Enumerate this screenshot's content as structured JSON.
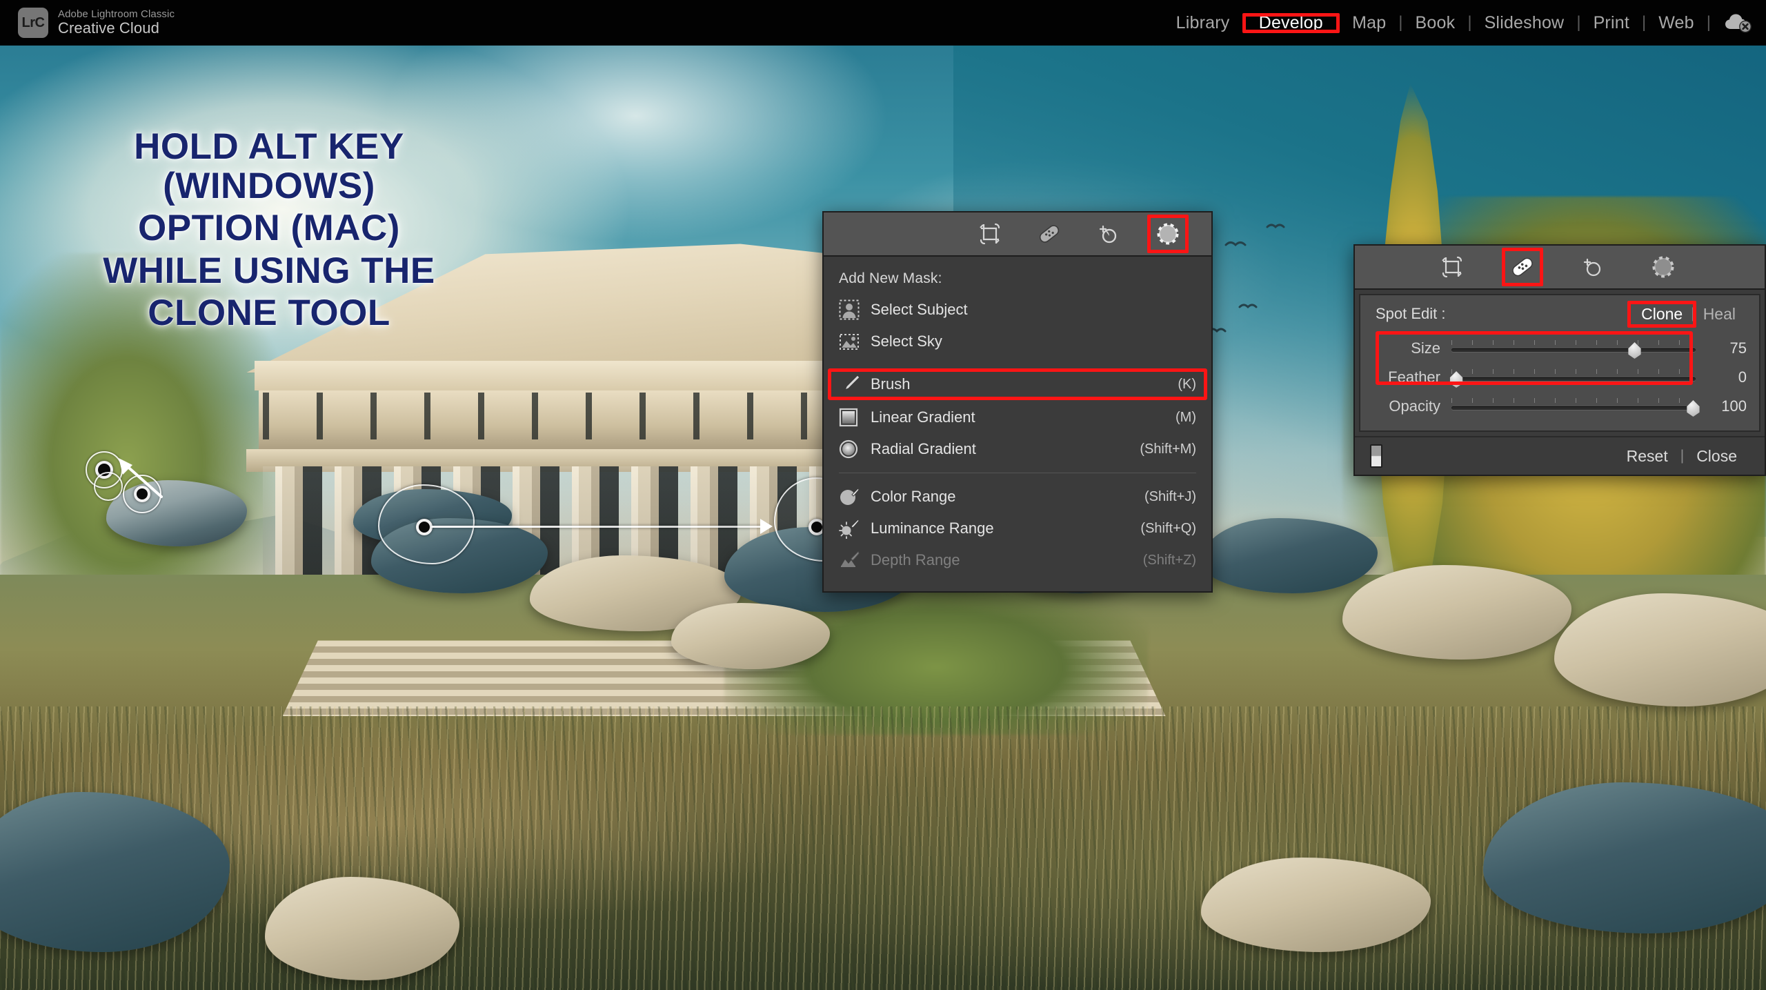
{
  "app": {
    "logo_text": "LrC",
    "product_line1": "Adobe Lightroom Classic",
    "product_line2": "Creative Cloud"
  },
  "modules": {
    "items": [
      {
        "label": "Library",
        "active": false
      },
      {
        "label": "Develop",
        "active": true,
        "highlighted": true
      },
      {
        "label": "Map",
        "active": false
      },
      {
        "label": "Book",
        "active": false
      },
      {
        "label": "Slideshow",
        "active": false
      },
      {
        "label": "Print",
        "active": false
      },
      {
        "label": "Web",
        "active": false
      }
    ],
    "separator": "|",
    "cloud_status_icon": "cloud-sync-off-icon"
  },
  "callout": {
    "line1": "HOLD ALT KEY (WINDOWS)",
    "line2": "OPTION (MAC)",
    "line3": "WHILE USING THE",
    "line4": "CLONE TOOL",
    "color": "#18256e",
    "glow": "#ffffff"
  },
  "mask_panel": {
    "toolbar": [
      {
        "icon": "crop-overlay-icon",
        "name": "crop-tool",
        "selected": false
      },
      {
        "icon": "healing-brush-icon",
        "name": "healing-tool",
        "selected": false
      },
      {
        "icon": "red-eye-icon",
        "name": "red-eye-tool",
        "selected": false
      },
      {
        "icon": "masking-circle-icon",
        "name": "masking-tool",
        "selected": true,
        "highlighted": true
      }
    ],
    "header": "Add New Mask:",
    "items": [
      {
        "label": "Select Subject",
        "shortcut": "",
        "icon": "select-subject-icon",
        "disabled": false,
        "highlighted": false
      },
      {
        "label": "Select Sky",
        "shortcut": "",
        "icon": "select-sky-icon",
        "disabled": false,
        "highlighted": false
      },
      {
        "label": "Brush",
        "shortcut": "(K)",
        "icon": "brush-icon",
        "disabled": false,
        "highlighted": true
      },
      {
        "label": "Linear Gradient",
        "shortcut": "(M)",
        "icon": "linear-gradient-icon",
        "disabled": false,
        "highlighted": false
      },
      {
        "label": "Radial Gradient",
        "shortcut": "(Shift+M)",
        "icon": "radial-gradient-icon",
        "disabled": false,
        "highlighted": false
      },
      {
        "label": "Color Range",
        "shortcut": "(Shift+J)",
        "icon": "color-range-icon",
        "disabled": false,
        "highlighted": false
      },
      {
        "label": "Luminance Range",
        "shortcut": "(Shift+Q)",
        "icon": "luminance-range-icon",
        "disabled": false,
        "highlighted": false
      },
      {
        "label": "Depth Range",
        "shortcut": "(Shift+Z)",
        "icon": "depth-range-icon",
        "disabled": true,
        "highlighted": false
      }
    ]
  },
  "spot_panel": {
    "toolbar": [
      {
        "icon": "crop-overlay-icon",
        "name": "crop-tool",
        "selected": false
      },
      {
        "icon": "healing-brush-icon",
        "name": "healing-tool",
        "selected": true,
        "highlighted": true
      },
      {
        "icon": "red-eye-icon",
        "name": "red-eye-tool",
        "selected": false
      },
      {
        "icon": "masking-circle-icon",
        "name": "masking-tool",
        "selected": false
      }
    ],
    "title": "Spot Edit :",
    "mode_clone": "Clone",
    "mode_sep": "|",
    "mode_heal": "Heal",
    "mode_selected": "Clone",
    "sliders": [
      {
        "label": "Size",
        "value": "75",
        "pct": 75,
        "highlighted": false
      },
      {
        "label": "Feather",
        "value": "0",
        "pct": 1,
        "highlighted": true
      },
      {
        "label": "Opacity",
        "value": "100",
        "pct": 100,
        "highlighted": true
      }
    ],
    "footer": {
      "toggle": "panel-visibility-toggle",
      "reset": "Reset",
      "sep": "|",
      "close": "Close"
    }
  },
  "highlight_color": "#fc1515"
}
